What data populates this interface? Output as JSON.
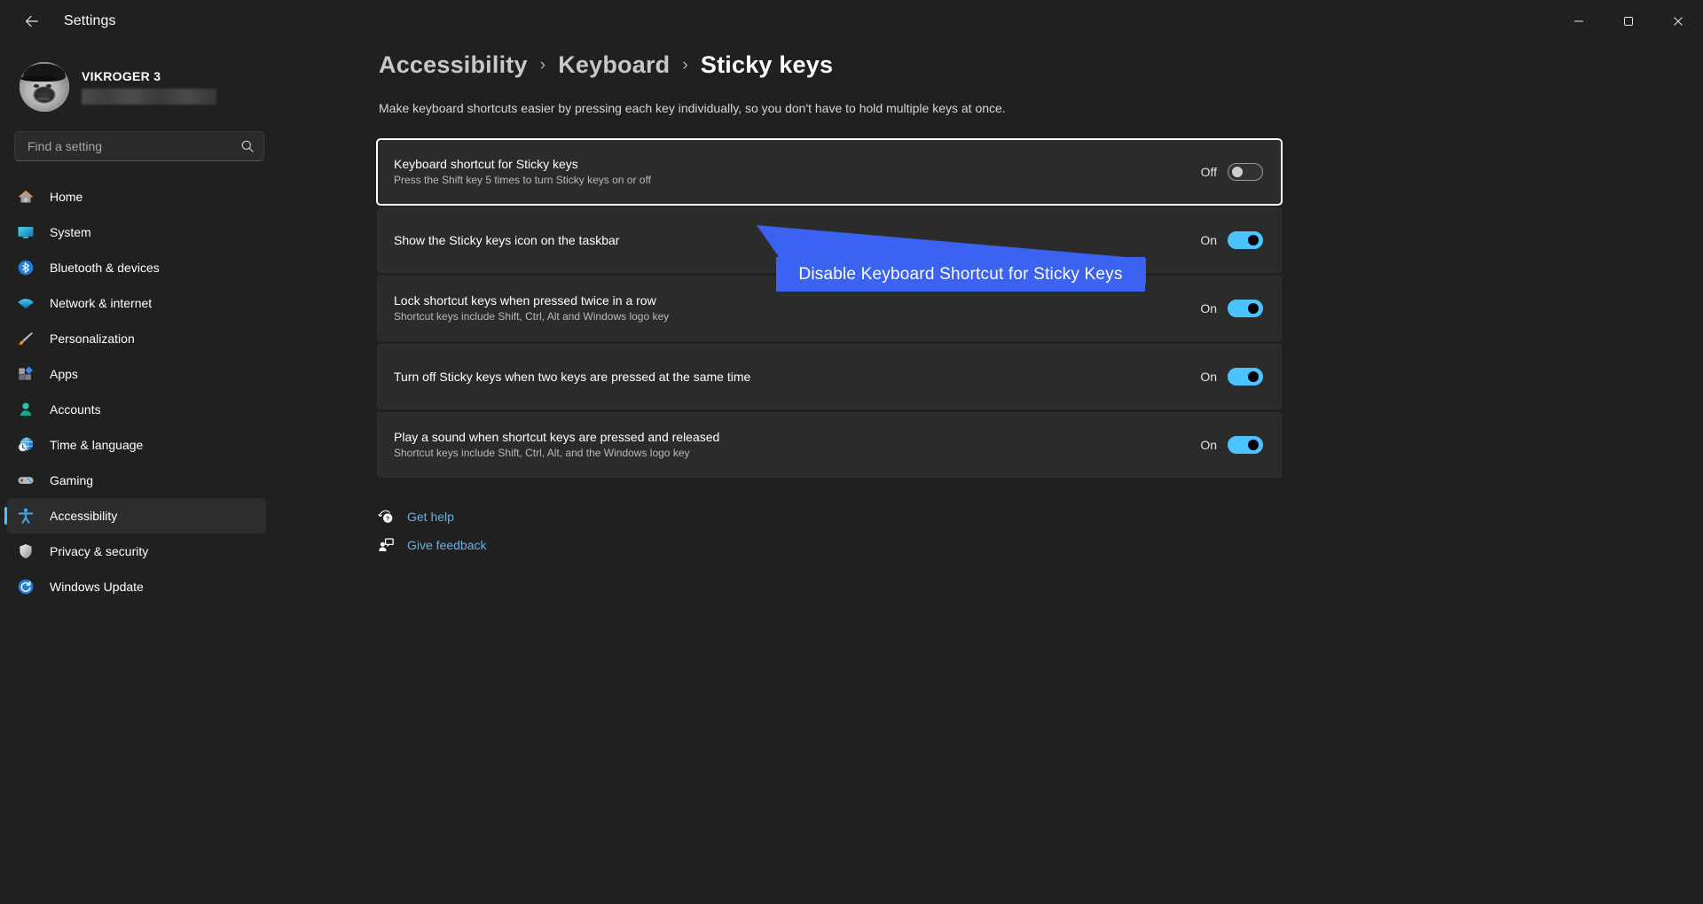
{
  "titlebar": {
    "back_label": "back-arrow",
    "title": "Settings",
    "minimize": "minimize",
    "maximize": "maximize",
    "close": "close"
  },
  "account": {
    "name": "VIKROGER 3",
    "email_redacted": ""
  },
  "search": {
    "placeholder": "Find a setting",
    "value": ""
  },
  "sidebar": {
    "items": [
      {
        "label": "Home",
        "icon": "home-icon",
        "active": false
      },
      {
        "label": "System",
        "icon": "system-icon",
        "active": false
      },
      {
        "label": "Bluetooth & devices",
        "icon": "bluetooth-icon",
        "active": false
      },
      {
        "label": "Network & internet",
        "icon": "wifi-icon",
        "active": false
      },
      {
        "label": "Personalization",
        "icon": "paintbrush-icon",
        "active": false
      },
      {
        "label": "Apps",
        "icon": "apps-icon",
        "active": false
      },
      {
        "label": "Accounts",
        "icon": "accounts-icon",
        "active": false
      },
      {
        "label": "Time & language",
        "icon": "clock-globe-icon",
        "active": false
      },
      {
        "label": "Gaming",
        "icon": "gamepad-icon",
        "active": false
      },
      {
        "label": "Accessibility",
        "icon": "accessibility-icon",
        "active": true
      },
      {
        "label": "Privacy & security",
        "icon": "shield-icon",
        "active": false
      },
      {
        "label": "Windows Update",
        "icon": "update-icon",
        "active": false
      }
    ]
  },
  "breadcrumb": {
    "items": [
      {
        "label": "Accessibility",
        "current": false
      },
      {
        "label": "Keyboard",
        "current": false
      },
      {
        "label": "Sticky keys",
        "current": true
      }
    ],
    "separator": "›"
  },
  "page": {
    "description": "Make keyboard shortcuts easier by pressing each key individually, so you don't have to hold multiple keys at once."
  },
  "settings_cards": [
    {
      "title": "Keyboard shortcut for Sticky keys",
      "subtitle": "Press the Shift key 5 times to turn Sticky keys on or off",
      "state_label": "Off",
      "state": "off",
      "focused": true
    },
    {
      "title": "Show the Sticky keys icon on the taskbar",
      "subtitle": "",
      "state_label": "On",
      "state": "on",
      "focused": false
    },
    {
      "title": "Lock shortcut keys when pressed twice in a row",
      "subtitle": "Shortcut keys include Shift, Ctrl, Alt and Windows logo key",
      "state_label": "On",
      "state": "on",
      "focused": false
    },
    {
      "title": "Turn off Sticky keys when two keys are pressed at the same time",
      "subtitle": "",
      "state_label": "On",
      "state": "on",
      "focused": false
    },
    {
      "title": "Play a sound when shortcut keys are pressed and released",
      "subtitle": "Shortcut keys include Shift, Ctrl, Alt, and the Windows logo key",
      "state_label": "On",
      "state": "on",
      "focused": false
    }
  ],
  "footer_links": [
    {
      "label": "Get help",
      "icon": "help-icon"
    },
    {
      "label": "Give feedback",
      "icon": "feedback-icon"
    }
  ],
  "annotation": {
    "text": "Disable Keyboard Shortcut for Sticky Keys",
    "color": "#3b62f0"
  }
}
